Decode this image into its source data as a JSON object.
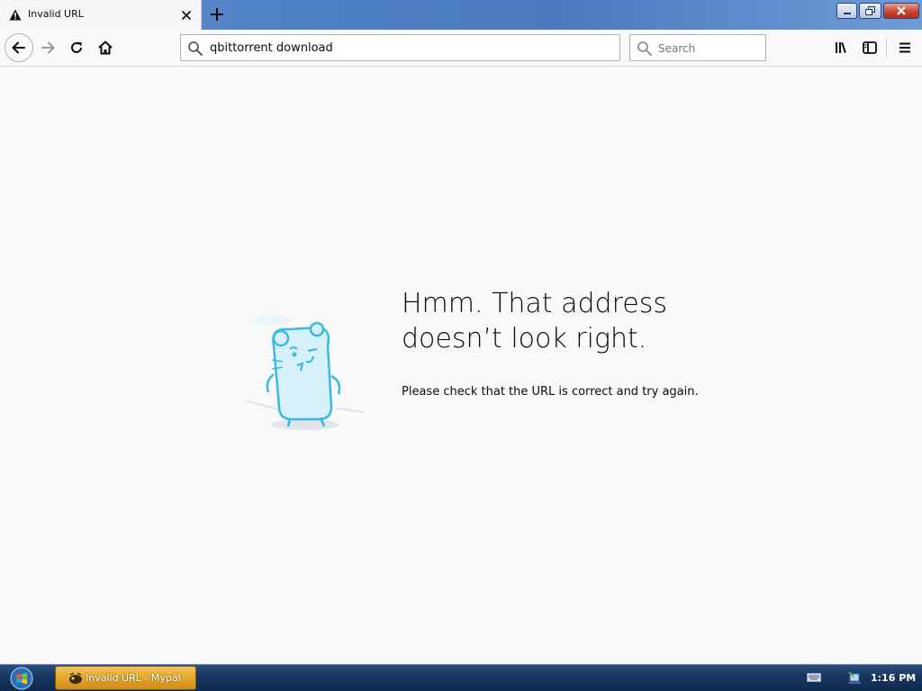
{
  "browser": {
    "tab": {
      "title": "Invalid URL",
      "icon": "warning-icon"
    },
    "address_bar": {
      "value": "qbittorrent download"
    },
    "search_bar": {
      "placeholder": "Search"
    }
  },
  "error_page": {
    "title": "Hmm. That address doesn’t look right.",
    "description": "Please check that the URL is correct and try again."
  },
  "taskbar": {
    "task_item_label": "Invalid URL - Mypal",
    "clock": "1:16 PM"
  },
  "colors": {
    "titlebar": "#4f7fc4",
    "close_button": "#c8452f",
    "taskbar": "#18355e",
    "task_item": "#e3a72e",
    "page_background": "#f9f9fa"
  }
}
